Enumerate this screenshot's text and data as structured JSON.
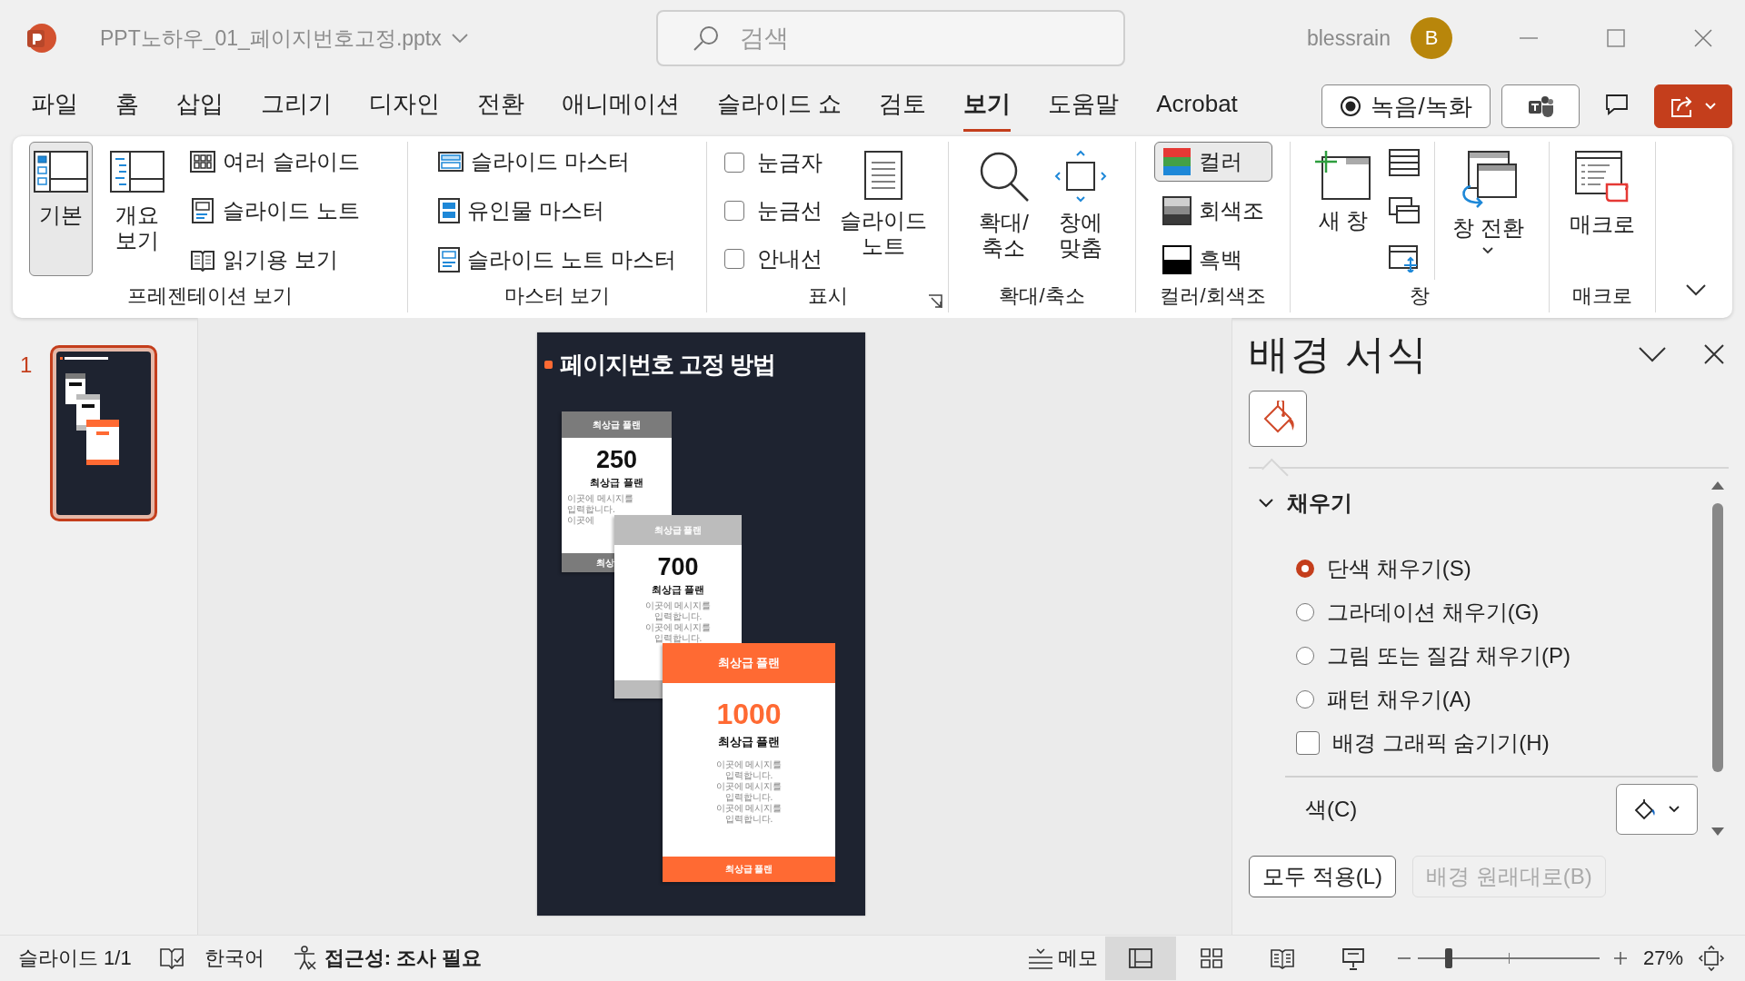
{
  "title_bar": {
    "file_name": "PPT노하우_01_페이지번호고정.pptx",
    "search_placeholder": "검색",
    "user": "blessrain",
    "avatar": "B"
  },
  "tabs": [
    {
      "label": "파일",
      "selected": false
    },
    {
      "label": "홈",
      "selected": false
    },
    {
      "label": "삽입",
      "selected": false
    },
    {
      "label": "그리기",
      "selected": false
    },
    {
      "label": "디자인",
      "selected": false
    },
    {
      "label": "전환",
      "selected": false
    },
    {
      "label": "애니메이션",
      "selected": false
    },
    {
      "label": "슬라이드 쇼",
      "selected": false
    },
    {
      "label": "검토",
      "selected": false
    },
    {
      "label": "보기",
      "selected": true
    },
    {
      "label": "도움말",
      "selected": false
    },
    {
      "label": "Acrobat",
      "selected": false
    }
  ],
  "record_button": "녹음/녹화",
  "ribbon": {
    "groups": [
      {
        "label": "프레젠테이션 보기",
        "columns": [
          [
            {
              "kind": "large",
              "lines": [
                "기본"
              ],
              "selected": true
            }
          ],
          [
            {
              "kind": "large",
              "lines": [
                "개요",
                "보기"
              ],
              "selected": false
            }
          ],
          [
            {
              "kind": "small",
              "label": "여러 슬라이드",
              "selected": false
            },
            {
              "kind": "small",
              "label": "슬라이드 노트",
              "selected": false
            },
            {
              "kind": "small",
              "label": "읽기용 보기",
              "selected": false
            }
          ]
        ]
      },
      {
        "label": "마스터 보기",
        "columns": [
          [
            {
              "kind": "small",
              "label": "슬라이드 마스터"
            },
            {
              "kind": "small",
              "label": "유인물 마스터"
            },
            {
              "kind": "small",
              "label": "슬라이드 노트 마스터"
            }
          ]
        ]
      },
      {
        "label": "표시",
        "launcher": true,
        "columns": [
          [
            {
              "kind": "check",
              "label": "눈금자",
              "checked": false
            },
            {
              "kind": "check",
              "label": "눈금선",
              "checked": false
            },
            {
              "kind": "check",
              "label": "안내선",
              "checked": false
            }
          ],
          [
            {
              "kind": "large",
              "lines": [
                "슬라이드",
                "노트"
              ]
            }
          ]
        ]
      },
      {
        "label": "확대/축소",
        "columns": [
          [
            {
              "kind": "large",
              "lines": [
                "확대/",
                "축소"
              ]
            }
          ],
          [
            {
              "kind": "large",
              "lines": [
                "창에",
                "맞춤"
              ]
            }
          ]
        ]
      },
      {
        "label": "컬러/회색조",
        "columns": [
          [
            {
              "kind": "small",
              "label": "컬러",
              "selected": true
            },
            {
              "kind": "small",
              "label": "회색조",
              "selected": false
            },
            {
              "kind": "small",
              "label": "흑백",
              "selected": false
            }
          ]
        ]
      },
      {
        "label": "창",
        "columns": [
          [
            {
              "kind": "large",
              "lines": [
                "새 창"
              ]
            }
          ],
          [
            {
              "kind": "icon"
            },
            {
              "kind": "icon"
            },
            {
              "kind": "icon"
            }
          ],
          [
            {
              "kind": "large",
              "lines": [
                "창 전환"
              ],
              "dropdown": true
            }
          ]
        ]
      },
      {
        "label": "매크로",
        "columns": [
          [
            {
              "kind": "large",
              "lines": [
                "매크로"
              ]
            }
          ]
        ]
      }
    ]
  },
  "thumbnails": [
    {
      "number": "1",
      "selected": true
    }
  ],
  "slide": {
    "title": "페이지번호 고정 방법",
    "cards": [
      {
        "kind": "gray",
        "header": "최상급 플랜",
        "number": "250",
        "name": "최상급 플랜",
        "body": [
          "이곳에 메시지를",
          "입력합니다.",
          "이곳에"
        ],
        "footer": "최상"
      },
      {
        "kind": "light",
        "header": "최상급 플랜",
        "number": "700",
        "name": "최상급 플랜",
        "body": [
          "이곳에 메시지를",
          "입력합니다.",
          "이곳에 메시지를",
          "입력합니다."
        ]
      },
      {
        "kind": "accent",
        "header": "최상급 플랜",
        "number": "1000",
        "name": "최상급 플랜",
        "body": [
          "이곳에 메시지를",
          "입력합니다.",
          "이곳에 메시지를",
          "입력합니다.",
          "이곳에 메시지를",
          "입력합니다."
        ],
        "footer": "최상급 플랜"
      }
    ]
  },
  "pane": {
    "title": "배경 서식",
    "section": {
      "label": "채우기",
      "expanded": true
    },
    "fill_options": [
      {
        "label": "단색 채우기(S)",
        "selected": true
      },
      {
        "label": "그라데이션 채우기(G)",
        "selected": false
      },
      {
        "label": "그림 또는 질감 채우기(P)",
        "selected": false
      },
      {
        "label": "패턴 채우기(A)",
        "selected": false
      }
    ],
    "hide_graphics": {
      "label": "배경 그래픽 숨기기(H)",
      "checked": false
    },
    "color_label": "색(C)",
    "buttons": [
      {
        "label": "모두 적용(L)",
        "disabled": false
      },
      {
        "label": "배경 원래대로(B)",
        "disabled": true
      }
    ]
  },
  "status_bar": {
    "slide": "슬라이드 1/1",
    "language": "한국어",
    "accessibility": "접근성: 조사 필요",
    "notes": "메모",
    "views": [
      {
        "selected": true
      },
      {
        "selected": false
      },
      {
        "selected": false
      },
      {
        "selected": false
      }
    ],
    "zoom_slider": {
      "level": 0.17
    },
    "zoom": "27%"
  }
}
